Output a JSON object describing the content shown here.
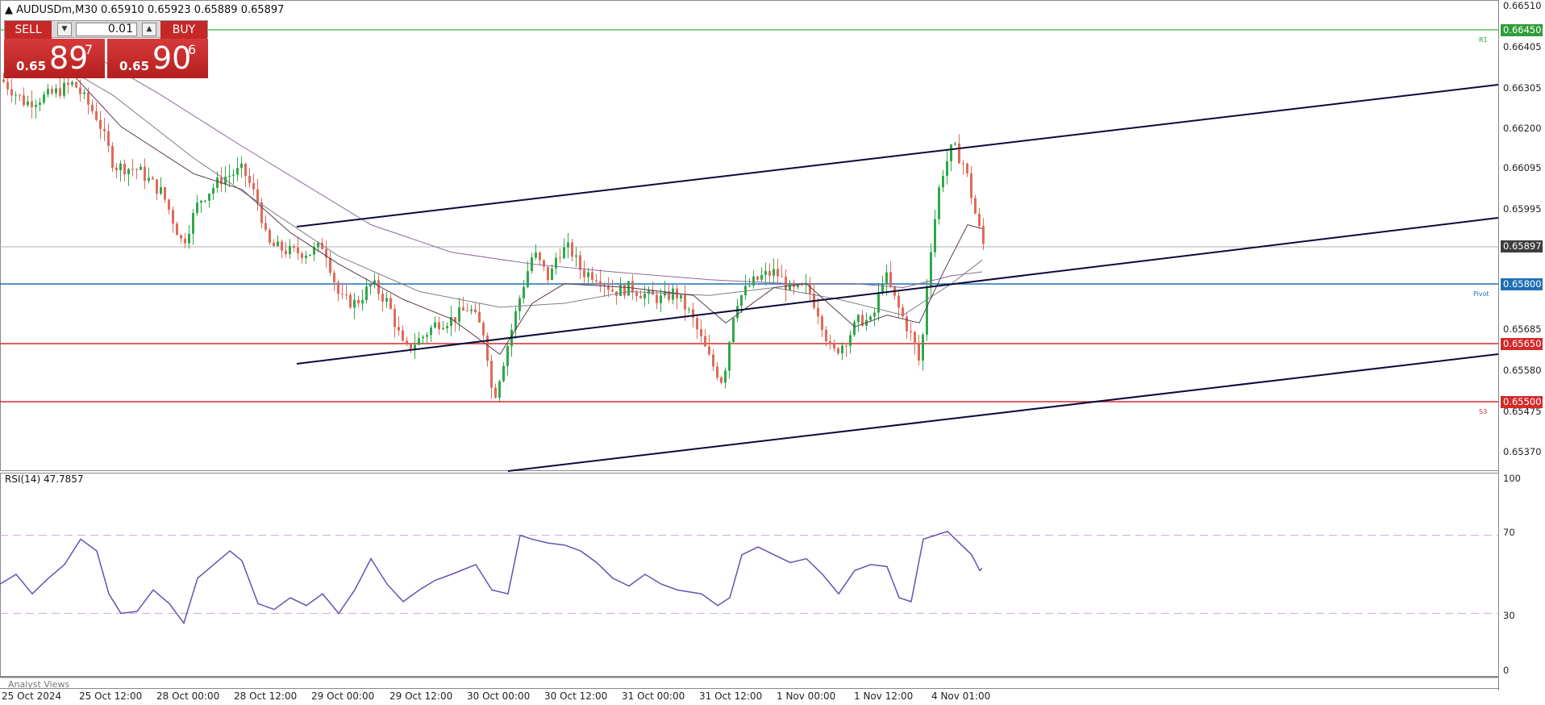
{
  "header": {
    "symbol_line": "AUDUSDm,M30  0.65910 0.65923 0.65889 0.65897"
  },
  "trade_panel": {
    "sell_label": "SELL",
    "buy_label": "BUY",
    "lot_value": "0.01",
    "sell_price_small": "0.65",
    "sell_price_big": "89",
    "sell_price_sup": "7",
    "buy_price_small": "0.65",
    "buy_price_big": "90",
    "buy_price_sup": "6"
  },
  "price_axis": {
    "labels": [
      "0.66510",
      "0.66405",
      "0.66305",
      "0.66200",
      "0.66095",
      "0.65995",
      "0.65685",
      "0.65580",
      "0.65475",
      "0.65370"
    ],
    "tags": [
      {
        "value": "0.66450",
        "color": "#2e9e3a"
      },
      {
        "value": "0.65897",
        "color": "#3d3d3d"
      },
      {
        "value": "0.65800",
        "color": "#1f6fb5"
      },
      {
        "value": "0.65650",
        "color": "#d42a2a"
      },
      {
        "value": "0.65500",
        "color": "#d42a2a"
      }
    ],
    "line_tags": {
      "r1": "R1",
      "pivot": "Pivot",
      "s3": "S3"
    }
  },
  "time_axis": {
    "labels": [
      "25 Oct 2024",
      "25 Oct 12:00",
      "28 Oct 00:00",
      "28 Oct 12:00",
      "29 Oct 00:00",
      "29 Oct 12:00",
      "30 Oct 00:00",
      "30 Oct 12:00",
      "31 Oct 00:00",
      "31 Oct 12:00",
      "1 Nov 00:00",
      "1 Nov 12:00",
      "4 Nov 01:00"
    ]
  },
  "rsi": {
    "title": "RSI(14) 47.7857",
    "period": 14,
    "current": 47.7857,
    "levels": [
      "100",
      "70",
      "30",
      "0"
    ],
    "line_color": "#6a4fb3"
  },
  "colors": {
    "bull": "#2fa84a",
    "bear": "#e06a5a",
    "resistance_line": "#5bbf5b",
    "pivot_line": "#1f6fb5",
    "support_line": "#d42a2a",
    "channel": "#0a0a3a"
  },
  "footer": {
    "analyst_views": "Analyst Views"
  }
}
